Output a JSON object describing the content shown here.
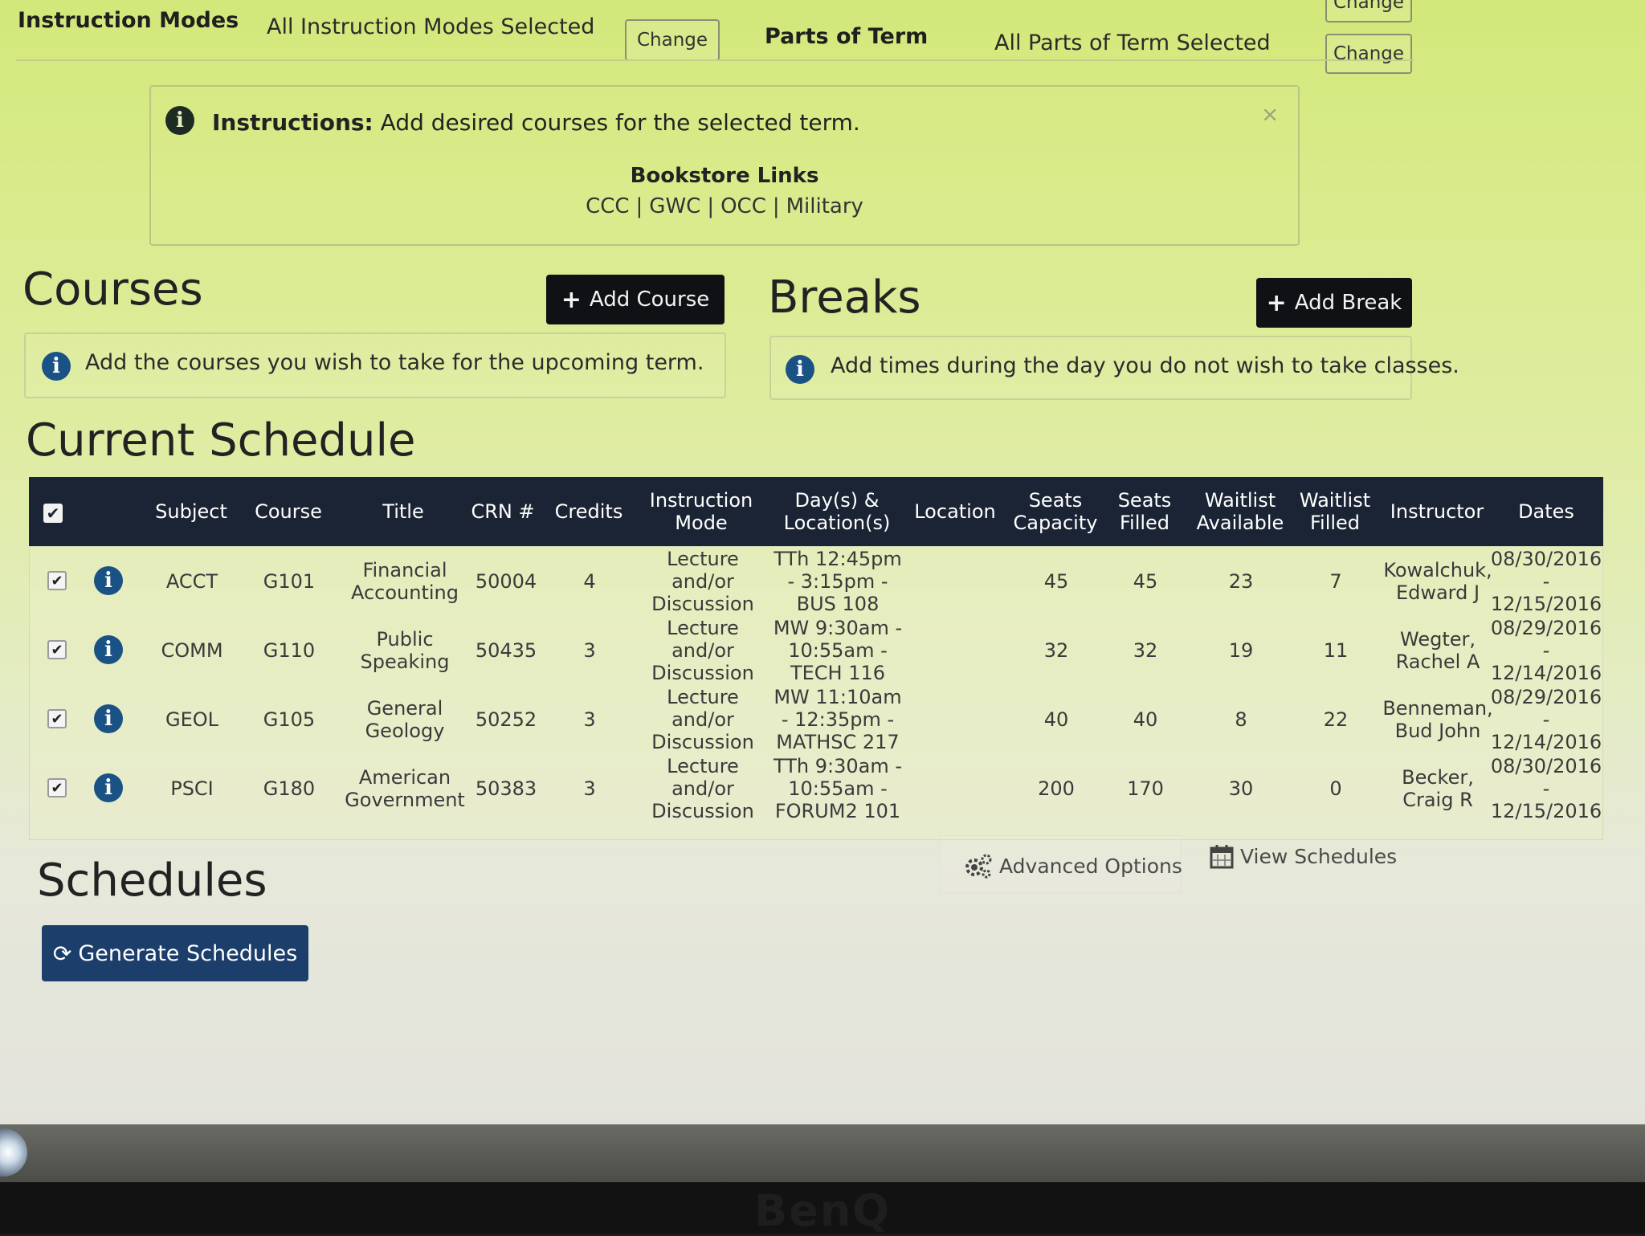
{
  "filters": {
    "instruction_modes_label": "Instruction Modes",
    "instruction_modes_value": "All Instruction Modes Selected",
    "instruction_modes_change": "Change",
    "parts_of_term_label": "Parts of Term",
    "parts_of_term_value": "All Parts of Term Selected",
    "parts_of_term_change": "Change",
    "parts_of_term_change_top": "Change"
  },
  "instructions": {
    "label": "Instructions:",
    "text": "Add desired courses for the selected term.",
    "close": "×",
    "bookstore_title": "Bookstore Links",
    "links": [
      "CCC",
      "GWC",
      "OCC",
      "Military"
    ],
    "separator": "|"
  },
  "courses": {
    "title": "Courses",
    "add_button": "Add Course",
    "hint": "Add the courses you wish to take for the upcoming term."
  },
  "breaks": {
    "title": "Breaks",
    "add_button": "Add Break",
    "hint": "Add times during the day you do not wish to take classes."
  },
  "schedule": {
    "title": "Current Schedule",
    "columns": [
      "Subject",
      "Course",
      "Title",
      "CRN #",
      "Credits",
      "Instruction Mode",
      "Day(s) & Location(s)",
      "Location",
      "Seats Capacity",
      "Seats Filled",
      "Waitlist Available",
      "Waitlist Filled",
      "Instructor",
      "Dates"
    ],
    "rows": [
      {
        "subject": "ACCT",
        "course": "G101",
        "title": "Financial Accounting",
        "crn": "50004",
        "credits": "4",
        "mode": "Lecture and/or Discussion",
        "days": "TTh 12:45pm - 3:15pm - BUS 108",
        "location": "",
        "cap": "45",
        "filled": "45",
        "wl_avail": "23",
        "wl_filled": "7",
        "instructor": "Kowalchuk, Edward J",
        "dates": "08/30/2016 - 12/15/2016"
      },
      {
        "subject": "COMM",
        "course": "G110",
        "title": "Public Speaking",
        "crn": "50435",
        "credits": "3",
        "mode": "Lecture and/or Discussion",
        "days": "MW 9:30am - 10:55am - TECH 116",
        "location": "",
        "cap": "32",
        "filled": "32",
        "wl_avail": "19",
        "wl_filled": "11",
        "instructor": "Wegter, Rachel A",
        "dates": "08/29/2016 - 12/14/2016"
      },
      {
        "subject": "GEOL",
        "course": "G105",
        "title": "General Geology",
        "crn": "50252",
        "credits": "3",
        "mode": "Lecture and/or Discussion",
        "days": "MW 11:10am - 12:35pm - MATHSC 217",
        "location": "",
        "cap": "40",
        "filled": "40",
        "wl_avail": "8",
        "wl_filled": "22",
        "instructor": "Benneman, Bud John",
        "dates": "08/29/2016 - 12/14/2016"
      },
      {
        "subject": "PSCI",
        "course": "G180",
        "title": "American Government",
        "crn": "50383",
        "credits": "3",
        "mode": "Lecture and/or Discussion",
        "days": "TTh 9:30am - 10:55am - FORUM2 101",
        "location": "",
        "cap": "200",
        "filled": "170",
        "wl_avail": "30",
        "wl_filled": "0",
        "instructor": "Becker, Craig R",
        "dates": "08/30/2016 - 12/15/2016"
      }
    ]
  },
  "options": {
    "advanced": "Advanced Options",
    "view": "View Schedules"
  },
  "schedules": {
    "title": "Schedules",
    "generate_button": "Generate Schedules"
  },
  "monitor": {
    "brand": "BenQ"
  }
}
